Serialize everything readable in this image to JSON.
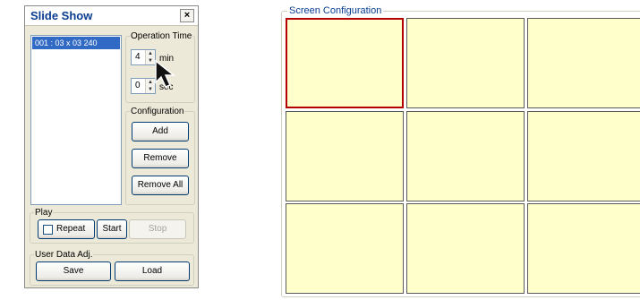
{
  "slide_show": {
    "title": "Slide Show",
    "close_label": "×",
    "list_items": [
      "001 :  03 x 03    240"
    ],
    "operation_time": {
      "legend": "Operation Time",
      "min_value": "4",
      "min_unit": "min",
      "sec_value": "0",
      "sec_unit": "sec"
    },
    "configuration": {
      "legend": "Configuration",
      "add_label": "Add",
      "remove_label": "Remove",
      "remove_all_label": "Remove All"
    },
    "play": {
      "legend": "Play",
      "repeat_label": "Repeat",
      "start_label": "Start",
      "stop_label": "Stop"
    },
    "user_data": {
      "legend": "User Data Adj.",
      "save_label": "Save",
      "load_label": "Load"
    }
  },
  "screen_configuration": {
    "legend": "Screen Configuration",
    "rows": 3,
    "cols": 3,
    "selected_cell": 1,
    "cell_color": "#ffffcc",
    "selected_border_color": "#b30000"
  }
}
